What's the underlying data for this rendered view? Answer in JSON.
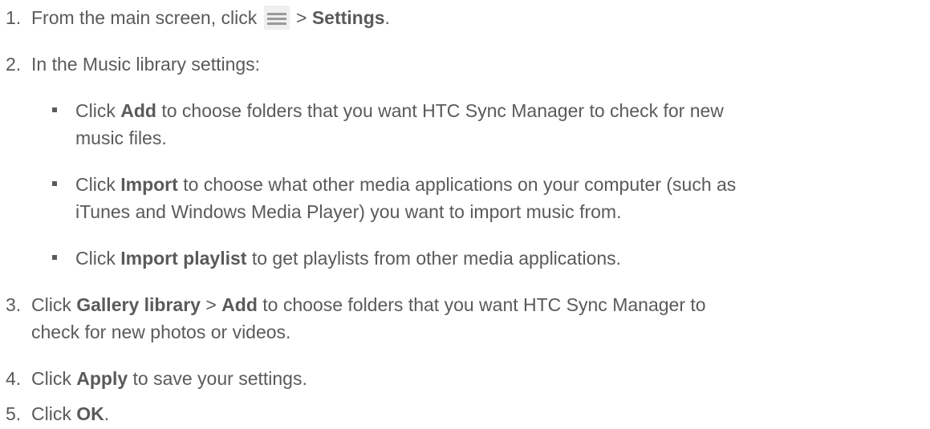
{
  "steps": [
    {
      "number": "1.",
      "pre": "From the main screen, click",
      "icon": "hamburger-menu-icon",
      "sep": ">",
      "bold": "Settings",
      "post": "."
    },
    {
      "number": "2.",
      "text": "In the Music library settings:",
      "bullets": [
        {
          "pre": "Click",
          "bold": "Add",
          "line1": "to choose folders that you want HTC Sync Manager to check for new",
          "line2": "music files."
        },
        {
          "pre": "Click",
          "bold": "Import",
          "line1": "to choose what other media applications on your computer (such as",
          "line2": "iTunes and Windows Media Player) you want to import music from."
        },
        {
          "pre": "Click",
          "bold": "Import playlist",
          "line1": "to get playlists from other media applications."
        }
      ]
    },
    {
      "number": "3.",
      "pre": "Click",
      "bold1": "Gallery library",
      "sep": ">",
      "bold2": "Add",
      "line1": "to choose folders that you want HTC Sync Manager to",
      "line2": "check for new photos or videos."
    },
    {
      "number": "4.",
      "pre": "Click",
      "bold": "Apply",
      "post": "to save your settings."
    },
    {
      "number": "5.",
      "pre": "Click",
      "bold": "OK",
      "post": "."
    }
  ]
}
